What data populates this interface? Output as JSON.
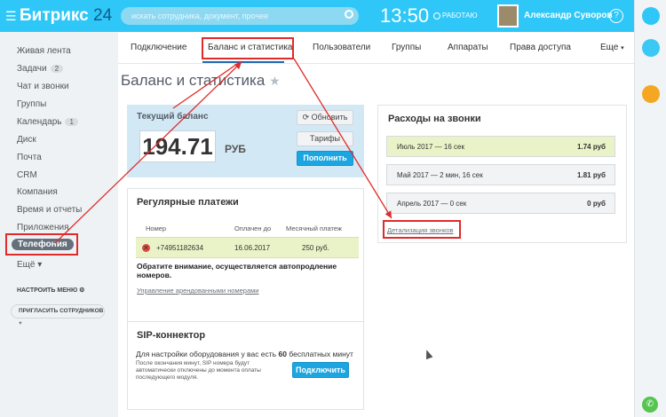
{
  "header": {
    "logo_text": "Битрикс",
    "logo_num": "24",
    "search_placeholder": "искать сотрудника, документ, прочее",
    "clock": "13:50",
    "work_status": "РАБОТАЮ",
    "user_name": "Александр Суворов",
    "help": "?"
  },
  "sidebar": {
    "items": [
      {
        "label": "Живая лента"
      },
      {
        "label": "Задачи",
        "badge": "2"
      },
      {
        "label": "Чат и звонки"
      },
      {
        "label": "Группы"
      },
      {
        "label": "Календарь",
        "badge": "1"
      },
      {
        "label": "Диск"
      },
      {
        "label": "Почта"
      },
      {
        "label": "CRM"
      },
      {
        "label": "Компания"
      },
      {
        "label": "Время и отчеты"
      },
      {
        "label": "Приложения"
      },
      {
        "label": "Телефония"
      },
      {
        "label": "Ещё"
      }
    ],
    "configure_menu": "НАСТРОИТЬ МЕНЮ",
    "invite": "ПРИГЛАСИТЬ СОТРУДНИКОВ"
  },
  "tabs": {
    "items": [
      "Подключение",
      "Баланс и статистика",
      "Пользователи",
      "Группы",
      "Аппараты",
      "Права доступа",
      "Еще"
    ]
  },
  "page": {
    "title": "Баланс и статистика",
    "star": "★"
  },
  "balance": {
    "label": "Текущий баланс",
    "value": "194.71",
    "currency": "РУБ",
    "refresh": "Обновить",
    "tariffs": "Тарифы",
    "topup": "Пополнить"
  },
  "payments": {
    "title": "Регулярные платежи",
    "headers": [
      "Номер",
      "Оплачен до",
      "Месячный платеж"
    ],
    "rows": [
      {
        "number": "+74951182634",
        "paid_until": "16.06.2017",
        "monthly": "250 руб."
      }
    ],
    "notice": "Обратите внимание, осуществляется автопродление номеров.",
    "manage_link": "Управление арендованными номерами"
  },
  "calls": {
    "title": "Расходы на звонки",
    "rows": [
      {
        "month": "Июль 2017 — 16 сек",
        "amount": "1.74 руб"
      },
      {
        "month": "Май 2017 — 2 мин, 16 сек",
        "amount": "1.81 руб"
      },
      {
        "month": "Апрель 2017 — 0 сек",
        "amount": "0 руб"
      }
    ],
    "details_link": "Детализация звонков"
  },
  "sip": {
    "title": "SIP-коннектор",
    "text_prefix": "Для настройки оборудования у вас есть",
    "free_minutes": "60",
    "text_suffix": "бесплатных минут",
    "small_text": "После окончания минут, SIP номера будут автоматически отключены до момента оплаты последующего модуля.",
    "connect": "Подключить"
  },
  "colors": {
    "header_bg": "#2fc7f7",
    "accent_blue": "#1ba6e1",
    "annotation_red": "#e02b2b",
    "highlight_row": "#eaf3c7"
  }
}
